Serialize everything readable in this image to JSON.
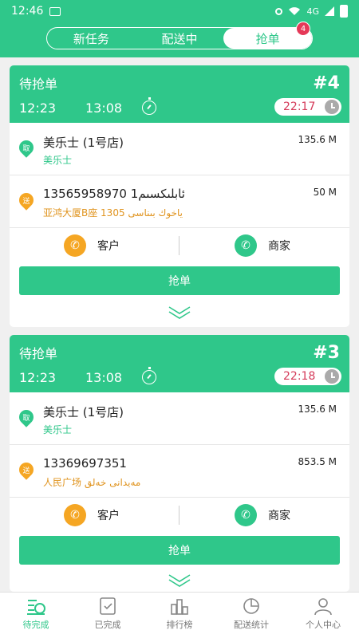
{
  "status_bar": {
    "time": "12:46",
    "net_label": "4G"
  },
  "tabs": [
    {
      "label": "新任务"
    },
    {
      "label": "配送中"
    },
    {
      "label": "抢单",
      "badge": "4"
    }
  ],
  "orders": [
    {
      "status": "待抢单",
      "number": "#4",
      "time_start": "12:23",
      "time_end": "13:08",
      "deadline": "22:17",
      "pickup": {
        "tag": "取",
        "name": "美乐士 (1号店)",
        "sub": "美乐士",
        "distance": "135.6 M"
      },
      "dropoff": {
        "tag": "送",
        "name": "13565958970 1ئابلىكسىم",
        "sub": "亚鸿大厦B座 1305 ياخوك بىناسى",
        "distance": "50 M"
      },
      "call_customer": "客户",
      "call_merchant": "商家",
      "grab_label": "抢单"
    },
    {
      "status": "待抢单",
      "number": "#3",
      "time_start": "12:23",
      "time_end": "13:08",
      "deadline": "22:18",
      "pickup": {
        "tag": "取",
        "name": "美乐士 (1号店)",
        "sub": "美乐士",
        "distance": "135.6 M"
      },
      "dropoff": {
        "tag": "送",
        "name": "13369697351",
        "sub": "人民广场 مەيدانى خەلق",
        "distance": "853.5 M"
      },
      "call_customer": "客户",
      "call_merchant": "商家",
      "grab_label": "抢单"
    }
  ],
  "bottom_nav": [
    {
      "label": "待完成",
      "icon": "pending-icon"
    },
    {
      "label": "已完成",
      "icon": "completed-icon"
    },
    {
      "label": "排行榜",
      "icon": "ranking-icon"
    },
    {
      "label": "配送统计",
      "icon": "stats-icon"
    },
    {
      "label": "个人中心",
      "icon": "profile-icon"
    }
  ],
  "colors": {
    "primary": "#2fc78a",
    "accent": "#f5a623",
    "deadline": "#d53b5a",
    "badge": "#e53958"
  }
}
